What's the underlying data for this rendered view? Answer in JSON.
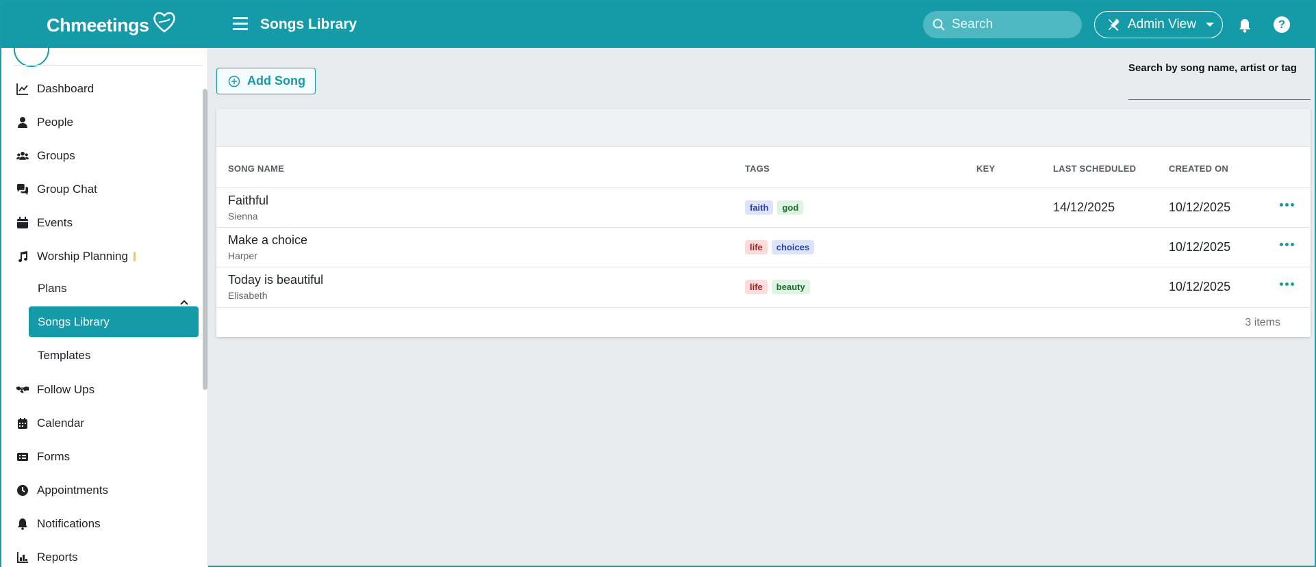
{
  "header": {
    "logo_text": "Chmeetings",
    "title": "Songs Library",
    "search_placeholder": "Search",
    "admin_label": "Admin View",
    "help_label": "?"
  },
  "sidebar": {
    "items": [
      {
        "label": "Dashboard",
        "icon": "chart-line-icon"
      },
      {
        "label": "People",
        "icon": "person-icon"
      },
      {
        "label": "Groups",
        "icon": "groups-icon"
      },
      {
        "label": "Group Chat",
        "icon": "chat-icon"
      },
      {
        "label": "Events",
        "icon": "calendar-icon"
      },
      {
        "label": "Worship Planning",
        "icon": "music-note-icon"
      },
      {
        "label": "Follow Ups",
        "icon": "handshake-icon"
      },
      {
        "label": "Calendar",
        "icon": "calendar-grid-icon"
      },
      {
        "label": "Forms",
        "icon": "form-icon"
      },
      {
        "label": "Appointments",
        "icon": "clock-icon"
      },
      {
        "label": "Notifications",
        "icon": "bell-icon"
      },
      {
        "label": "Reports",
        "icon": "bar-chart-icon"
      }
    ],
    "worship_sub": [
      {
        "label": "Plans"
      },
      {
        "label": "Songs Library"
      },
      {
        "label": "Templates"
      }
    ]
  },
  "main": {
    "add_song_label": "Add Song",
    "search_label": "Search by song name, artist or tag",
    "search_value": "",
    "columns": [
      "SONG NAME",
      "TAGS",
      "KEY",
      "LAST SCHEDULED",
      "CREATED ON"
    ],
    "rows": [
      {
        "name": "Faithful",
        "artist": "Sienna",
        "tags": [
          {
            "text": "faith",
            "color": "#2a3fa8",
            "bg": "#dde4fa"
          },
          {
            "text": "god",
            "color": "#1e6b2f",
            "bg": "#dcf4e1"
          }
        ],
        "key": "",
        "last_scheduled": "14/12/2025",
        "created_on": "10/12/2025"
      },
      {
        "name": "Make a choice",
        "artist": "Harper",
        "tags": [
          {
            "text": "life",
            "color": "#a3221f",
            "bg": "#fadcdc"
          },
          {
            "text": "choices",
            "color": "#2a3fa8",
            "bg": "#dde4fa"
          }
        ],
        "key": "",
        "last_scheduled": "",
        "created_on": "10/12/2025"
      },
      {
        "name": "Today is beautiful",
        "artist": "Elisabeth",
        "tags": [
          {
            "text": "life",
            "color": "#a3221f",
            "bg": "#fadcdc"
          },
          {
            "text": "beauty",
            "color": "#1e6b2f",
            "bg": "#dcf4e1"
          }
        ],
        "key": "",
        "last_scheduled": "",
        "created_on": "10/12/2025"
      }
    ],
    "items_count": "3 items"
  },
  "colors": {
    "accent": "#159aa8",
    "background": "#e9ecee"
  }
}
